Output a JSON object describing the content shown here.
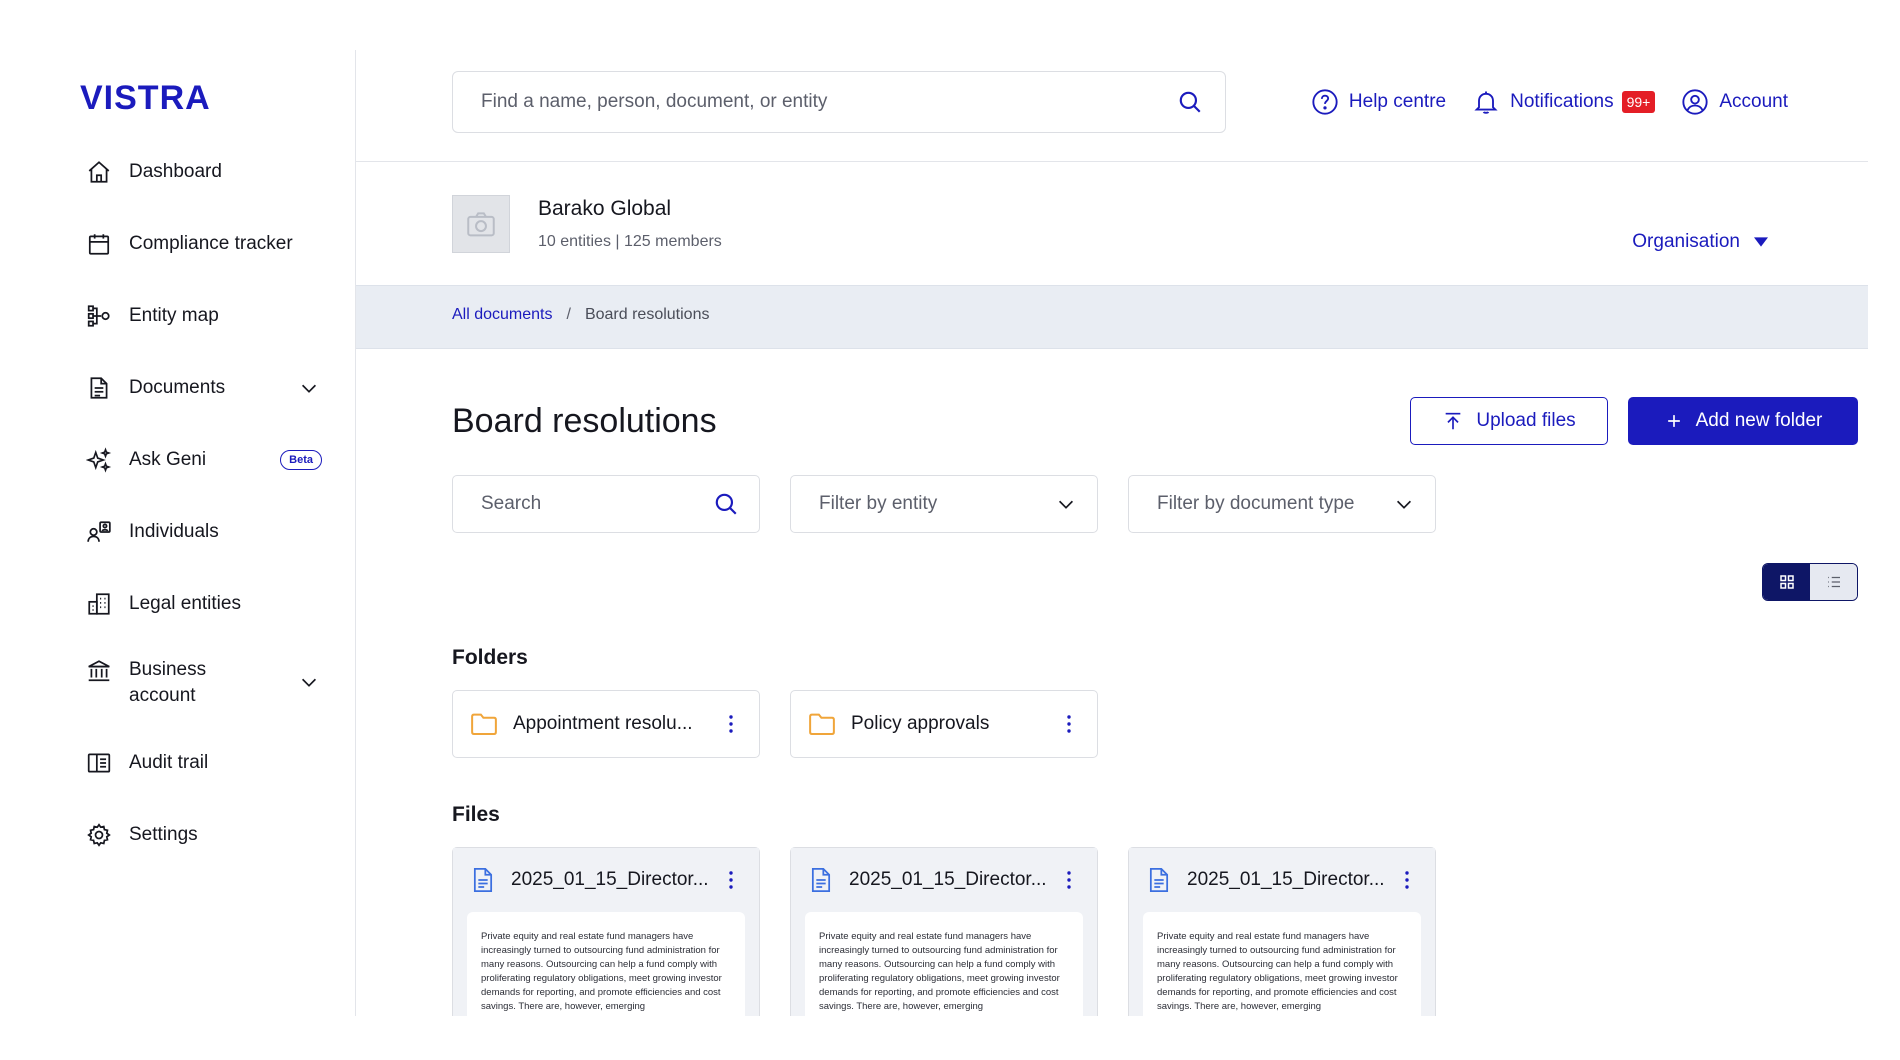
{
  "brand": {
    "logo_text": "VISTRA",
    "accent": "#1b1bbd",
    "dark_navy": "#0e1666",
    "badge_red": "#e41e26",
    "folder_orange": "#f0a53a"
  },
  "sidebar": {
    "items": [
      {
        "label": "Dashboard",
        "icon": "home-icon"
      },
      {
        "label": "Compliance tracker",
        "icon": "calendar-icon"
      },
      {
        "label": "Entity map",
        "icon": "entity-map-icon"
      },
      {
        "label": "Documents",
        "icon": "document-icon",
        "expandable": true
      },
      {
        "label": "Ask Geni",
        "icon": "sparkle-icon",
        "badge": "Beta"
      },
      {
        "label": "Individuals",
        "icon": "individuals-icon"
      },
      {
        "label": "Legal entities",
        "icon": "building-icon"
      },
      {
        "label": "Business account",
        "icon": "bank-icon",
        "expandable": true
      },
      {
        "label": "Audit trail",
        "icon": "audit-book-icon"
      },
      {
        "label": "Settings",
        "icon": "gear-icon"
      }
    ]
  },
  "topbar": {
    "search_placeholder": "Find a name, person, document, or entity",
    "help_label": "Help centre",
    "notifications_label": "Notifications",
    "notifications_count": "99+",
    "account_label": "Account"
  },
  "org": {
    "name": "Barako Global",
    "meta": "10 entities | 125 members",
    "switch_label": "Organisation"
  },
  "breadcrumb": {
    "root": "All documents",
    "separator": "/",
    "current": "Board resolutions"
  },
  "page": {
    "title": "Board resolutions",
    "upload_label": "Upload files",
    "add_folder_label": "Add new folder"
  },
  "filters": {
    "search_placeholder": "Search",
    "entity_placeholder": "Filter by entity",
    "doctype_placeholder": "Filter by document type"
  },
  "view": {
    "active": "grid"
  },
  "folders": {
    "heading": "Folders",
    "items": [
      {
        "name": "Appointment resolu..."
      },
      {
        "name": "Policy approvals"
      }
    ]
  },
  "files": {
    "heading": "Files",
    "items": [
      {
        "name": "2025_01_15_Director...",
        "preview": "Private equity and real estate fund managers have increasingly turned to outsourcing fund administration for many reasons. Outsourcing can help a fund comply with proliferating regulatory obligations, meet growing investor demands for reporting, and promote efficiencies and cost savings. There are, however, emerging"
      },
      {
        "name": "2025_01_15_Director...",
        "preview": "Private equity and real estate fund managers have increasingly turned to outsourcing fund administration for many reasons. Outsourcing can help a fund comply with proliferating regulatory obligations, meet growing investor demands for reporting, and promote efficiencies and cost savings. There are, however, emerging"
      },
      {
        "name": "2025_01_15_Director...",
        "preview": "Private equity and real estate fund managers have increasingly turned to outsourcing fund administration for many reasons. Outsourcing can help a fund comply with proliferating regulatory obligations, meet growing investor demands for reporting, and promote efficiencies and cost savings. There are, however, emerging"
      }
    ]
  }
}
